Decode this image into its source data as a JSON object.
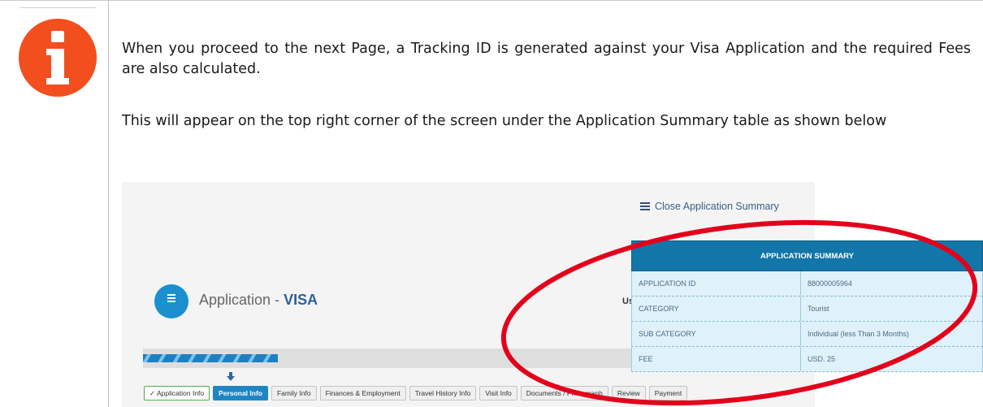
{
  "paragraphs": {
    "first": "When you proceed to the next Page, a Tracking ID is generated against your Visa Application and the required Fees are also calculated.",
    "second": "This will appear on the top right corner of the screen under the Application Summary table as shown below"
  },
  "screenshot": {
    "close_summary_label": "Close Application Summary",
    "app_title_prefix": "Application - ",
    "app_title_type": "VISA",
    "partial_label": "Us",
    "progress": 0.26,
    "steps": [
      {
        "label": "✓ Application Info",
        "state": "done"
      },
      {
        "label": "Personal Info",
        "state": "active"
      },
      {
        "label": "Family Info",
        "state": "todo"
      },
      {
        "label": "Finances & Employment",
        "state": "todo"
      },
      {
        "label": "Travel History Info",
        "state": "todo"
      },
      {
        "label": "Visit Info",
        "state": "todo"
      },
      {
        "label": "Documents / Photograph",
        "state": "todo"
      },
      {
        "label": "Review",
        "state": "todo"
      },
      {
        "label": "Payment",
        "state": "todo"
      }
    ],
    "summary": {
      "title": "APPLICATION SUMMARY",
      "rows": [
        {
          "key": "APPLICATION ID",
          "value": "88000005964"
        },
        {
          "key": "CATEGORY",
          "value": "Tourist"
        },
        {
          "key": "SUB CATEGORY",
          "value": "Individual (less Than 3 Months)"
        },
        {
          "key": "FEE",
          "value": "USD. 25"
        }
      ]
    }
  },
  "colors": {
    "info_icon": "#f24e1e",
    "highlight_ellipse": "#e3001b",
    "summary_header": "#1276a8"
  }
}
